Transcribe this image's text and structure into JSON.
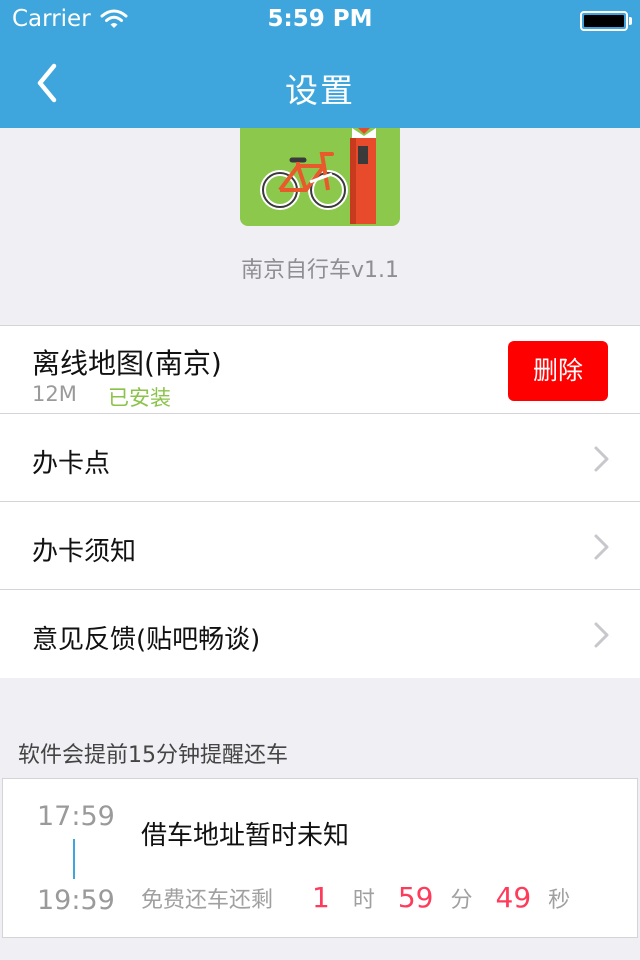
{
  "status_bar": {
    "carrier": "Carrier",
    "time": "5:59 PM"
  },
  "nav": {
    "title": "设置",
    "back_icon": "chevron-left-icon"
  },
  "app": {
    "name": "南京自行车v1.1",
    "icon": "bicycle-app-icon"
  },
  "settings": {
    "offline_map": {
      "title": "离线地图(南京)",
      "size": "12M",
      "status": "已安装",
      "delete_label": "删除"
    },
    "items": [
      {
        "label": "办卡点"
      },
      {
        "label": "办卡须知"
      },
      {
        "label": "意见反馈(贴吧畅谈)"
      }
    ]
  },
  "reminder": {
    "hint": "软件会提前15分钟提醒还车",
    "start_time": "17:59",
    "end_time": "19:59",
    "address": "借车地址暂时未知",
    "countdown_prefix": "免费还车还剩",
    "hours": "1",
    "hours_unit": "时",
    "minutes": "59",
    "minutes_unit": "分",
    "seconds": "49",
    "seconds_unit": "秒"
  },
  "colors": {
    "nav_bar": "#3ea6dc",
    "delete_button": "#ff0000",
    "installed_status": "#8bc34a",
    "countdown_number": "#ff3b5c",
    "background": "#efeff4"
  }
}
